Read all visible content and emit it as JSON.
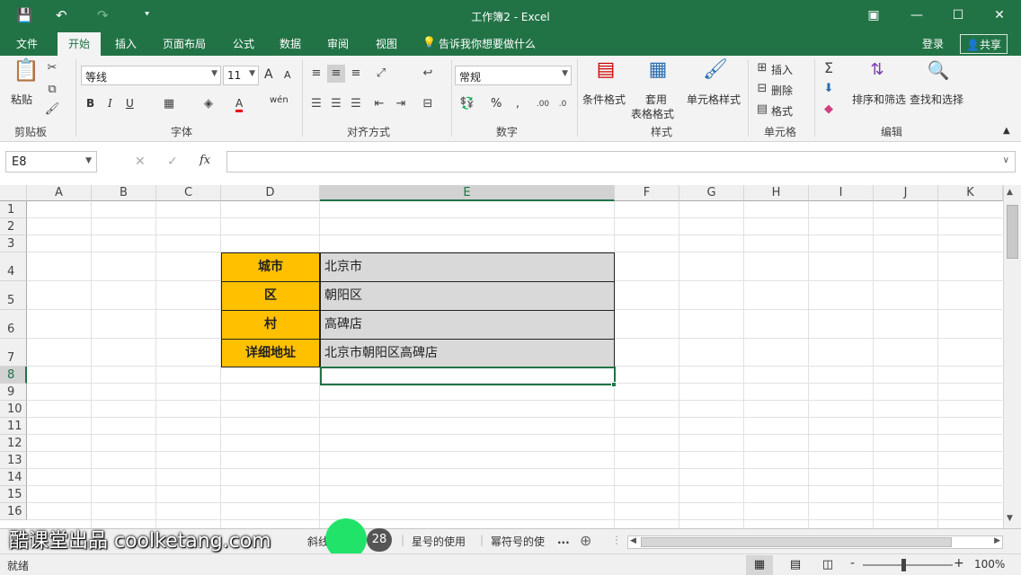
{
  "window": {
    "title": "工作簿2 - Excel"
  },
  "title_icons": {
    "save": "💾",
    "undo": "↶",
    "redo": "↷",
    "customize": "⯆",
    "restore_ribbon": "▣",
    "minimize": "—",
    "maximize": "☐",
    "close": "✕"
  },
  "tabs": [
    {
      "label": "文件"
    },
    {
      "label": "开始"
    },
    {
      "label": "插入"
    },
    {
      "label": "页面布局"
    },
    {
      "label": "公式"
    },
    {
      "label": "数据"
    },
    {
      "label": "审阅"
    },
    {
      "label": "视图"
    }
  ],
  "tellme": "告诉我你想要做什么",
  "login": "登录",
  "share": "共享",
  "ribbon": {
    "clipboard": {
      "paste": "粘贴",
      "group": "剪贴板"
    },
    "font": {
      "name": "等线",
      "size": "11",
      "bold": "B",
      "italic": "I",
      "underline": "U",
      "group": "字体",
      "grow": "A",
      "shrink": "A",
      "fontcolor": "A",
      "wen": "wén"
    },
    "align": {
      "group": "对齐方式"
    },
    "number": {
      "format": "常规",
      "percent": "%",
      "group": "数字"
    },
    "styles": {
      "cond": "条件格式",
      "table1": "套用",
      "table2": "表格格式",
      "cell": "单元格样式",
      "group": "样式"
    },
    "cells": {
      "insert": "插入",
      "delete": "删除",
      "format": "格式",
      "group": "单元格"
    },
    "editing": {
      "sort": "排序和筛选",
      "find": "查找和选择",
      "group": "编辑"
    }
  },
  "formula": {
    "namebox": "E8",
    "fx": "fx",
    "cancel": "✕",
    "enter": "✓"
  },
  "columns": [
    "A",
    "B",
    "C",
    "D",
    "E",
    "F",
    "G",
    "H",
    "I",
    "J",
    "K"
  ],
  "rows": [
    "1",
    "2",
    "3",
    "4",
    "5",
    "6",
    "7",
    "8",
    "9",
    "10",
    "11",
    "12",
    "13",
    "14",
    "15",
    "16"
  ],
  "cells": [
    {
      "label": "城市",
      "value": "北京市"
    },
    {
      "label": "区",
      "value": "朝阳区"
    },
    {
      "label": "村",
      "value": "高碑店"
    },
    {
      "label": "详细地址",
      "value": "北京市朝阳区高碑店"
    }
  ],
  "sheets": {
    "tab1": "斜线符号的",
    "tab2": "星号的使用",
    "tab3": "幂符号的使",
    "more": "..."
  },
  "watermark": "酷课堂出品 coolketang.com",
  "badge": "28",
  "status": {
    "ready": "就绪",
    "zoom": "100%",
    "minus": "-",
    "plus": "+"
  },
  "colors": {
    "excel_green": "#217346",
    "label_fill": "#ffc000",
    "value_fill": "#d9d9d9"
  }
}
